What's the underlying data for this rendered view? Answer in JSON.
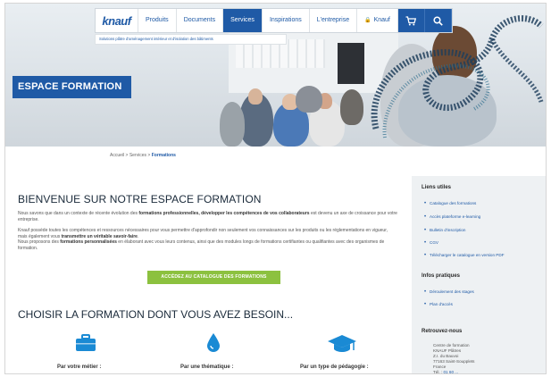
{
  "nav": {
    "logo": "knauf",
    "items": [
      {
        "label": "Produits",
        "active": false
      },
      {
        "label": "Documents",
        "active": false
      },
      {
        "label": "Services",
        "active": true
      },
      {
        "label": "Inspirations",
        "active": false
      },
      {
        "label": "L'entreprise",
        "active": false
      },
      {
        "label": "Knauf",
        "active": false
      }
    ],
    "icons": [
      "cart-icon",
      "search-icon"
    ],
    "tagline": "Solutions plâtre d'aménagement intérieur et d'isolation des bâtiments"
  },
  "hero": {
    "title": "ESPACE FORMATION"
  },
  "breadcrumb": {
    "items": [
      "Accueil",
      "Services"
    ],
    "separator": ">",
    "current": "Formations"
  },
  "main": {
    "heading": "BIENVENUE SUR NOTRE ESPACE FORMATION",
    "intro": {
      "before": "Nous savons que dans un contexte de récente évolution des ",
      "bold1": "formations professionnelles",
      "middle": ", développer les compétences de vos collaborateurs",
      "after": " est devenu un axe de croissance pour votre entreprise."
    },
    "body": {
      "line1_before": "Knauf possède toutes les compétences et ressources nécessaires pour vous permettre d'approfondir non seulement vos connaissances sur les produits ou les réglementations en vigueur, mais également vous ",
      "line1_bold": "transmettre un véritable savoir-faire",
      "line1_after": ".",
      "line2_before": "Nous proposons des ",
      "line2_bold": "formations personnalisées",
      "line2_after": " en élaborant avec vous leurs contenus, ainsi que des modules longs de formations certifiantes ou qualifiantes avec des organismes de formation."
    },
    "cta": "ACCÉDEZ AU CATALOGUE DES FORMATIONS",
    "choose_heading": "CHOISIR LA FORMATION DONT VOUS AVEZ BESOIN...",
    "choices": [
      {
        "label": "Par votre métier :",
        "icon": "briefcase-icon"
      },
      {
        "label": "Par une thématique :",
        "icon": "drop-icon"
      },
      {
        "label": "Par un type de pédagogie :",
        "icon": "graduation-cap-icon"
      }
    ]
  },
  "sidebar": {
    "useful_links": {
      "title": "Liens utiles",
      "items": [
        "Catalogue des formations",
        "Accès plateforme e-learning",
        "Bulletin d'inscription",
        "CGV",
        "Télécharger le catalogue en version PDF"
      ]
    },
    "practical_info": {
      "title": "Infos pratiques",
      "items": [
        "Déroulement des stages",
        "Plan d'accès"
      ]
    },
    "find_us": {
      "title": "Retrouvez-nous",
      "address": [
        "Centre de formation",
        "KNAUF Plâtres",
        "Z.I. du Bauvoi",
        "77163 Saint-Soupplets",
        "France"
      ],
      "phone_label": "Tél. :",
      "phone": "01 60 ..."
    }
  },
  "colors": {
    "brand_blue": "#1f5aa6",
    "cta_green": "#8cc13f",
    "sidebar_bg": "#eef1f3",
    "icon_blue": "#1a8ad4"
  }
}
